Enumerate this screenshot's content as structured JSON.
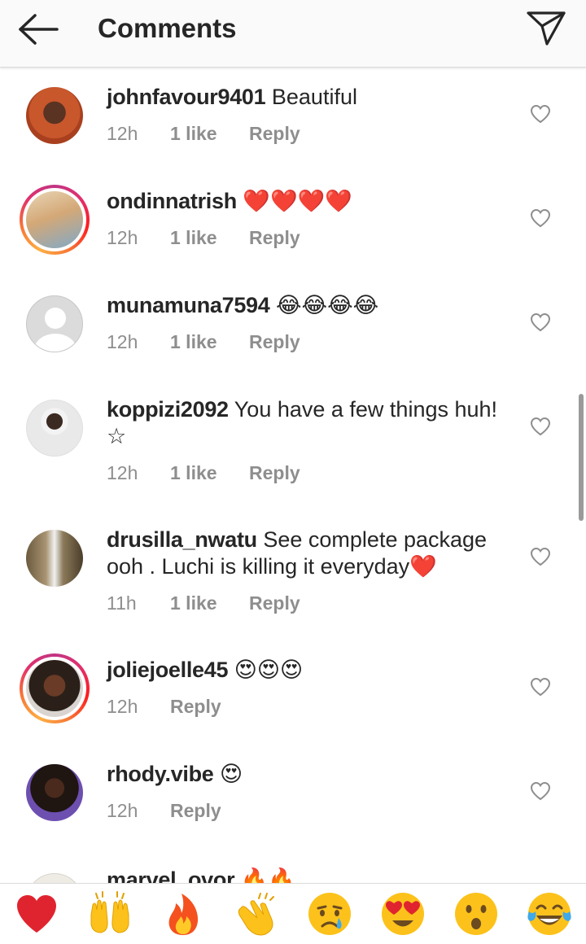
{
  "header": {
    "title": "Comments",
    "back_icon": "arrow-left-icon",
    "share_icon": "send-icon"
  },
  "comments": [
    {
      "username": "johnfavour9401",
      "text": "Beautiful",
      "time": "12h",
      "likes": "1 like",
      "reply": "Reply"
    },
    {
      "username": "ondinnatrish",
      "text": "❤️❤️❤️❤️",
      "time": "12h",
      "likes": "1 like",
      "reply": "Reply"
    },
    {
      "username": "munamuna7594",
      "text": "😂😂😂😂",
      "time": "12h",
      "likes": "1 like",
      "reply": "Reply"
    },
    {
      "username": "koppizi2092",
      "text": "You have a few things huh!",
      "text2": "☆",
      "time": "12h",
      "likes": "1 like",
      "reply": "Reply"
    },
    {
      "username": "drusilla_nwatu",
      "text": "See complete package",
      "text2": "ooh . Luchi is killing it everyday❤️",
      "time": "11h",
      "likes": "1 like",
      "reply": "Reply"
    },
    {
      "username": "joliejoelle45",
      "text": "😍😍😍",
      "time": "12h",
      "reply": "Reply"
    },
    {
      "username": "rhody.vibe",
      "text": "😍",
      "time": "12h",
      "reply": "Reply"
    },
    {
      "username": "marvel_ovor",
      "text": "🔥🔥"
    }
  ],
  "emoji_bar": [
    "❤️",
    "🙌",
    "🔥",
    "👏",
    "😢",
    "😍",
    "😮",
    "😂"
  ],
  "colors": {
    "text": "#262626",
    "secondary": "#8e8e8e",
    "header_bg": "#fafafa",
    "divider": "#dbdbdb"
  }
}
